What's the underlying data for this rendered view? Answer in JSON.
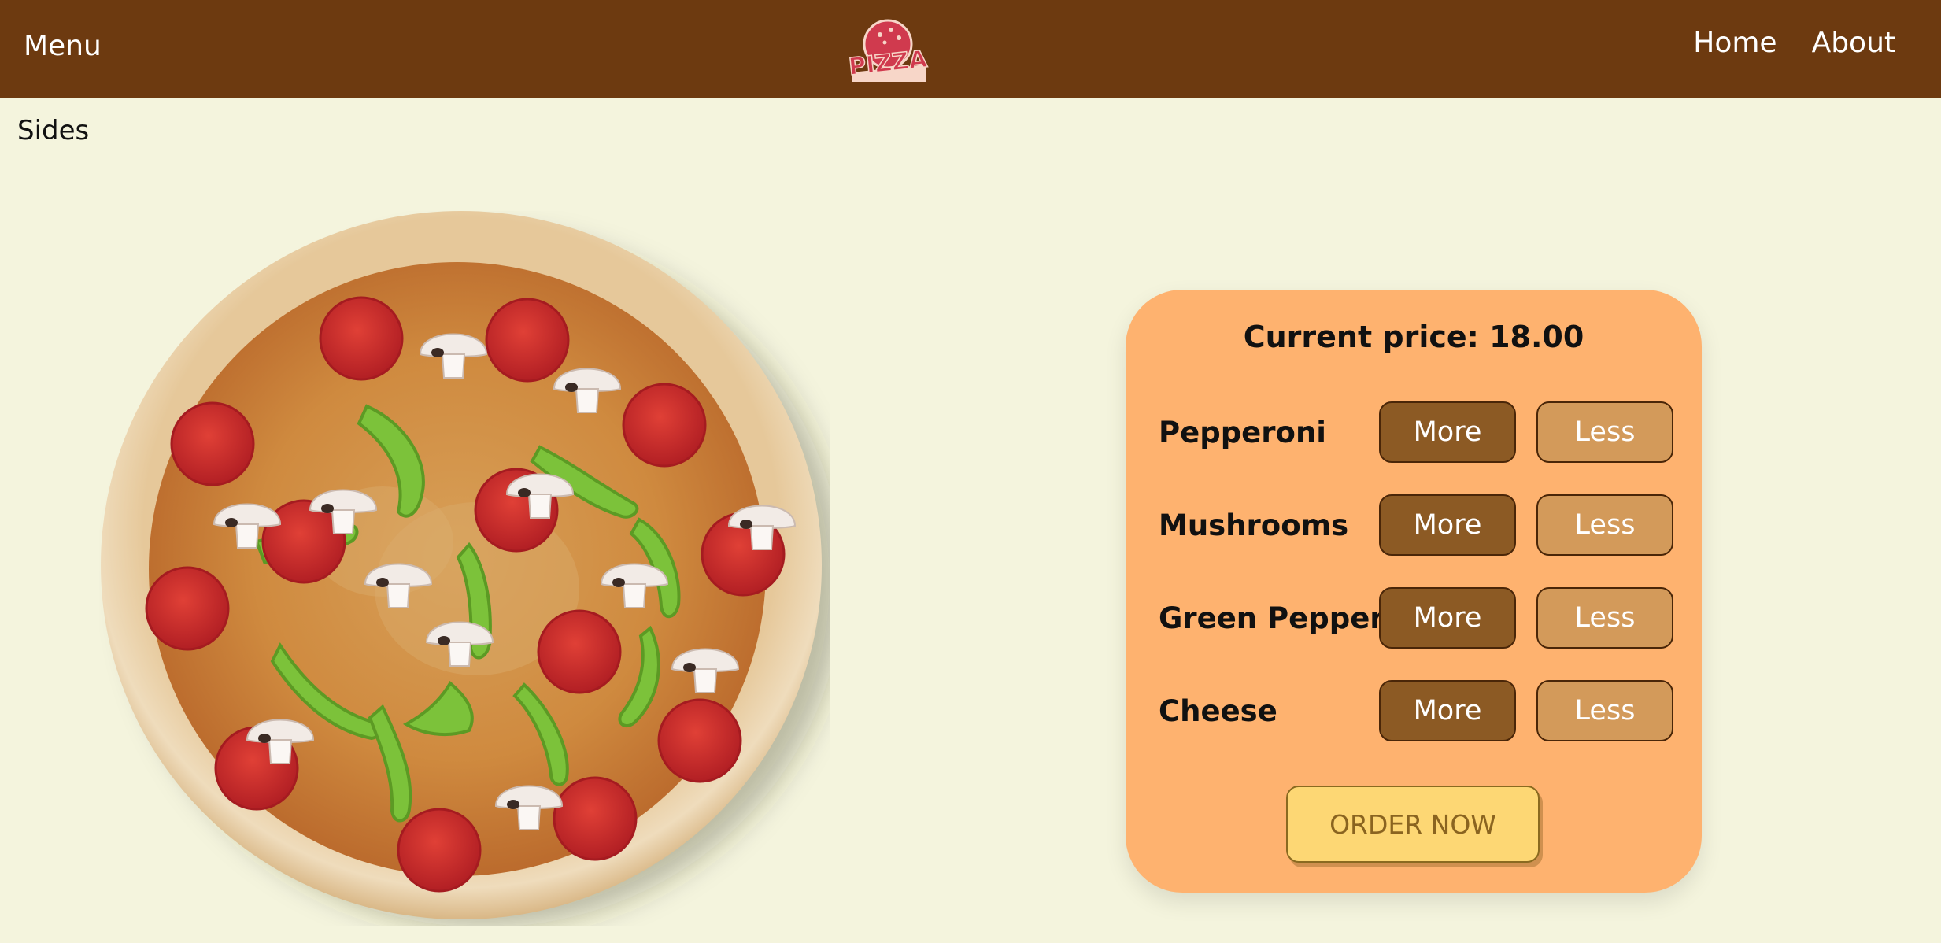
{
  "header": {
    "menu_label": "Menu",
    "logo_text": "PIZZA",
    "nav": {
      "home": "Home",
      "about": "About"
    }
  },
  "sides_label": "Sides",
  "panel": {
    "price_text": "Current price: 18.00",
    "toppings": [
      {
        "name": "Pepperoni",
        "more": "More",
        "less": "Less"
      },
      {
        "name": "Mushrooms",
        "more": "More",
        "less": "Less"
      },
      {
        "name": "Green Pepper",
        "more": "More",
        "less": "Less"
      },
      {
        "name": "Cheese",
        "more": "More",
        "less": "Less"
      }
    ],
    "order_label": "ORDER NOW"
  },
  "pizza_toppings": {
    "pepperoni_count": 13,
    "mushroom_count": 12,
    "green_pepper_count": 10
  },
  "colors": {
    "header_bg": "#6d3a10",
    "page_bg": "#f4f4dd",
    "panel_bg": "#feb26f",
    "more_button": "#8c5a24",
    "less_button": "#d39a5a",
    "order_button": "#fdd774",
    "pepperoni": "#c8282a",
    "green_pepper": "#7cc23a",
    "mushroom": "#f2ebe6"
  }
}
